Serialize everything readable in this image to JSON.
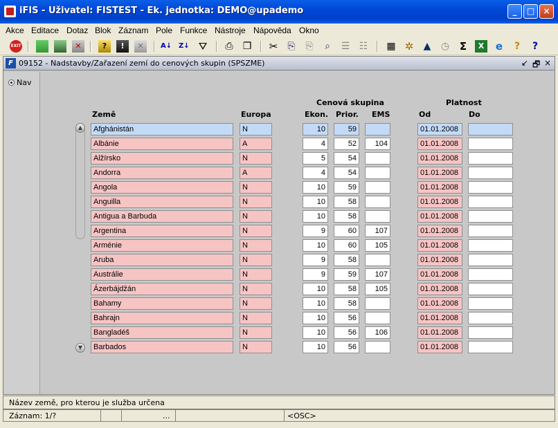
{
  "window": {
    "title": "iFIS - Uživatel: FISTEST - Ek. jednotka: DEMO@upademo",
    "minimize": "_",
    "maximize": "□",
    "close": "×"
  },
  "menu": [
    "Akce",
    "Editace",
    "Dotaz",
    "Blok",
    "Záznam",
    "Pole",
    "Funkce",
    "Nástroje",
    "Nápověda",
    "Okno"
  ],
  "toolbar": {
    "exit_label": "EXIT",
    "icons": [
      "exit-icon",
      "insert-record-icon",
      "copy-record-icon",
      "delete-record-icon",
      "query-enter-icon",
      "query-execute-icon",
      "query-cancel-icon",
      "sort-asc-icon",
      "sort-desc-icon",
      "filter-icon",
      "print-icon",
      "cut-icon",
      "copy-icon",
      "paste-icon",
      "find-icon",
      "list-icon",
      "calculator-icon",
      "settings-icon",
      "mountain-icon",
      "clock-icon",
      "sum-icon",
      "excel-icon",
      "ie-icon",
      "help-book-icon",
      "help-icon"
    ]
  },
  "form": {
    "title": "09152 - Nadstavby/Zařazení zemí do cenových skupin (SPSZME)",
    "ficon": "F",
    "controls": [
      "↙",
      "🗗",
      "×"
    ]
  },
  "nav": {
    "label": "Nav"
  },
  "headers": {
    "zeme": "Země",
    "europa": "Europa",
    "cenova_skupina": "Cenová skupina",
    "ekon": "Ekon.",
    "prior": "Prior.",
    "ems": "EMS",
    "platnost": "Platnost",
    "od": "Od",
    "do": "Do"
  },
  "rows": [
    {
      "zeme": "Afghánistán",
      "europa": "N",
      "ekon": "10",
      "prior": "59",
      "ems": "",
      "od": "01.01.2008",
      "do": ""
    },
    {
      "zeme": "Albánie",
      "europa": "A",
      "ekon": "4",
      "prior": "52",
      "ems": "104",
      "od": "01.01.2008",
      "do": ""
    },
    {
      "zeme": "Alžírsko",
      "europa": "N",
      "ekon": "5",
      "prior": "54",
      "ems": "",
      "od": "01.01.2008",
      "do": ""
    },
    {
      "zeme": "Andorra",
      "europa": "A",
      "ekon": "4",
      "prior": "54",
      "ems": "",
      "od": "01.01.2008",
      "do": ""
    },
    {
      "zeme": "Angola",
      "europa": "N",
      "ekon": "10",
      "prior": "59",
      "ems": "",
      "od": "01.01.2008",
      "do": ""
    },
    {
      "zeme": "Anguilla",
      "europa": "N",
      "ekon": "10",
      "prior": "58",
      "ems": "",
      "od": "01.01.2008",
      "do": ""
    },
    {
      "zeme": "Antigua a Barbuda",
      "europa": "N",
      "ekon": "10",
      "prior": "58",
      "ems": "",
      "od": "01.01.2008",
      "do": ""
    },
    {
      "zeme": "Argentina",
      "europa": "N",
      "ekon": "9",
      "prior": "60",
      "ems": "107",
      "od": "01.01.2008",
      "do": ""
    },
    {
      "zeme": "Arménie",
      "europa": "N",
      "ekon": "10",
      "prior": "60",
      "ems": "105",
      "od": "01.01.2008",
      "do": ""
    },
    {
      "zeme": "Aruba",
      "europa": "N",
      "ekon": "9",
      "prior": "58",
      "ems": "",
      "od": "01.01.2008",
      "do": ""
    },
    {
      "zeme": "Austrálie",
      "europa": "N",
      "ekon": "9",
      "prior": "59",
      "ems": "107",
      "od": "01.01.2008",
      "do": ""
    },
    {
      "zeme": "Ázerbájdžán",
      "europa": "N",
      "ekon": "10",
      "prior": "58",
      "ems": "105",
      "od": "01.01.2008",
      "do": ""
    },
    {
      "zeme": "Bahamy",
      "europa": "N",
      "ekon": "10",
      "prior": "58",
      "ems": "",
      "od": "01.01.2008",
      "do": ""
    },
    {
      "zeme": "Bahrajn",
      "europa": "N",
      "ekon": "10",
      "prior": "56",
      "ems": "",
      "od": "01.01.2008",
      "do": ""
    },
    {
      "zeme": "Bangladéš",
      "europa": "N",
      "ekon": "10",
      "prior": "56",
      "ems": "106",
      "od": "01.01.2008",
      "do": ""
    },
    {
      "zeme": "Barbados",
      "europa": "N",
      "ekon": "10",
      "prior": "56",
      "ems": "",
      "od": "01.01.2008",
      "do": ""
    }
  ],
  "status": {
    "hint": "Název země, pro kterou je služba určena",
    "record": "Záznam: 1/?",
    "dots": "...",
    "osc": "<OSC>"
  },
  "colors": {
    "required_field": "#f7c4c4",
    "current_row": "#c3daf6",
    "optional_field": "#ffffff"
  }
}
